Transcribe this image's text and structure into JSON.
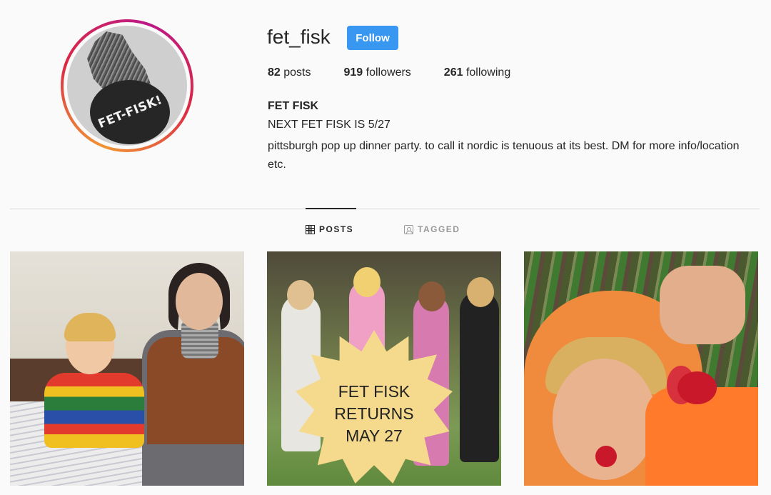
{
  "profile": {
    "username": "fet_fisk",
    "follow_label": "Follow",
    "avatar_text": "FET-FISK!",
    "stats": [
      {
        "count": "82",
        "label": "posts"
      },
      {
        "count": "919",
        "label": "followers"
      },
      {
        "count": "261",
        "label": "following"
      }
    ],
    "full_name": "FET FISK",
    "bio_line1": "NEXT FET FISK IS 5/27",
    "bio_line2": "pittsburgh pop up dinner party. to call it nordic is tenuous at its best. DM for more info/location etc."
  },
  "tabs": [
    {
      "label": "POSTS",
      "icon": "grid-icon",
      "active": true
    },
    {
      "label": "TAGGED",
      "icon": "tag-icon",
      "active": false
    }
  ],
  "posts": [
    {
      "kind": "photo"
    },
    {
      "kind": "photo",
      "overlay_text": "FET FISK\nRETURNS\nMAY 27"
    },
    {
      "kind": "photo"
    }
  ],
  "colors": {
    "follow_button": "#3897f0",
    "background": "#fafafa",
    "text": "#262626",
    "inactive_tab": "#999999",
    "burst": "#f5d98c"
  }
}
